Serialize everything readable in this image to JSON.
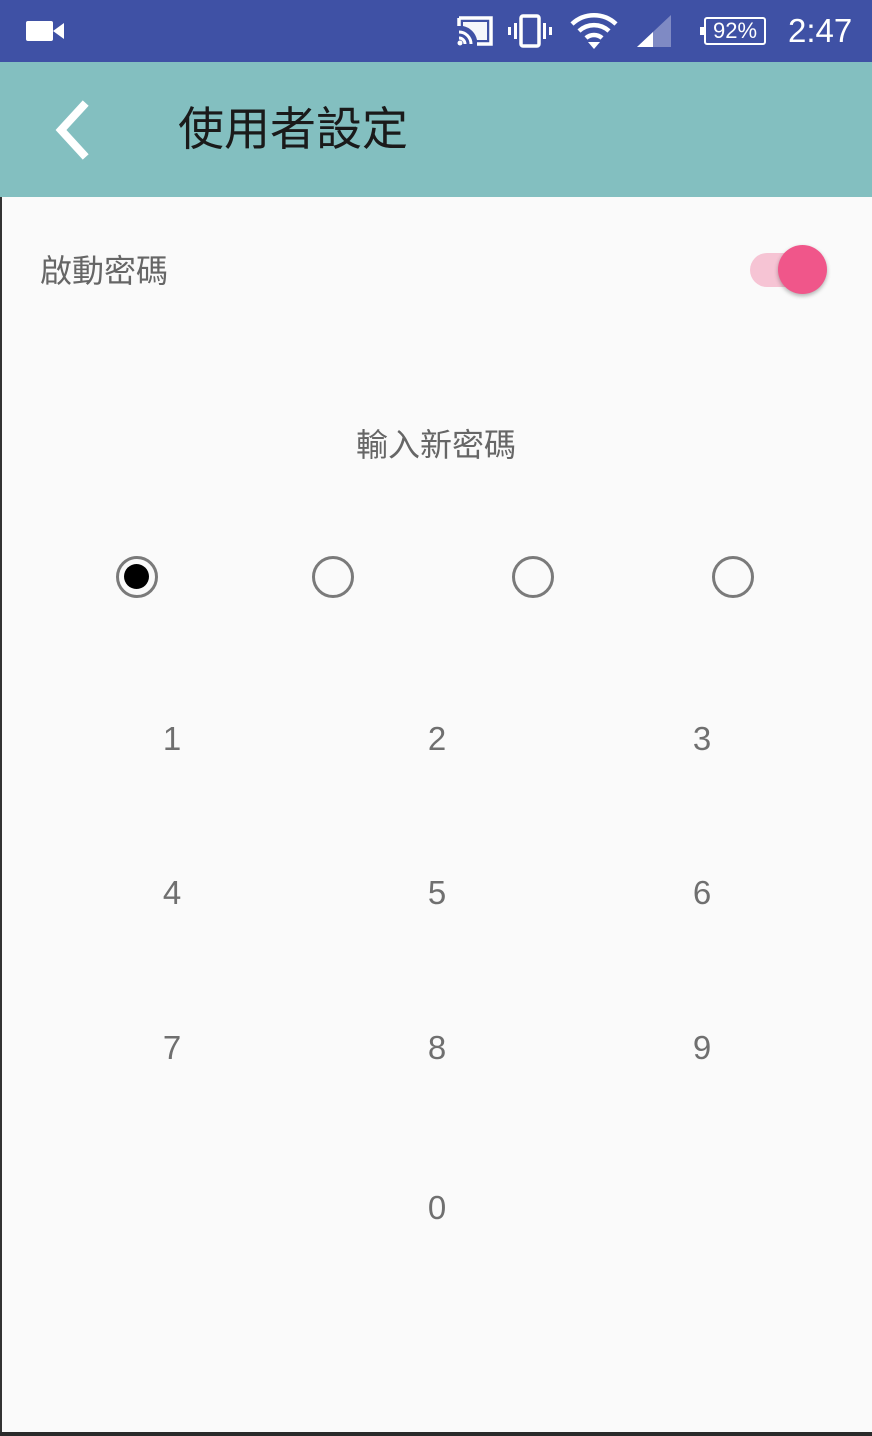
{
  "status_bar": {
    "battery_level": "92%",
    "time": "2:47",
    "icons": [
      "video-icon",
      "cast-icon",
      "vibrate-icon",
      "wifi-icon",
      "signal-icon",
      "battery-icon"
    ]
  },
  "app_bar": {
    "title": "使用者設定",
    "back_icon": "chevron-left-icon"
  },
  "settings": {
    "enable_password_label": "啟動密碼",
    "enable_password_on": true
  },
  "pin_entry": {
    "prompt": "輸入新密碼",
    "length": 4,
    "entered": 1
  },
  "keypad": {
    "keys": [
      "1",
      "2",
      "3",
      "4",
      "5",
      "6",
      "7",
      "8",
      "9",
      "0"
    ]
  },
  "colors": {
    "status_bar": "#3f51a5",
    "app_bar": "#83bfc0",
    "toggle_accent": "#f0568a"
  }
}
